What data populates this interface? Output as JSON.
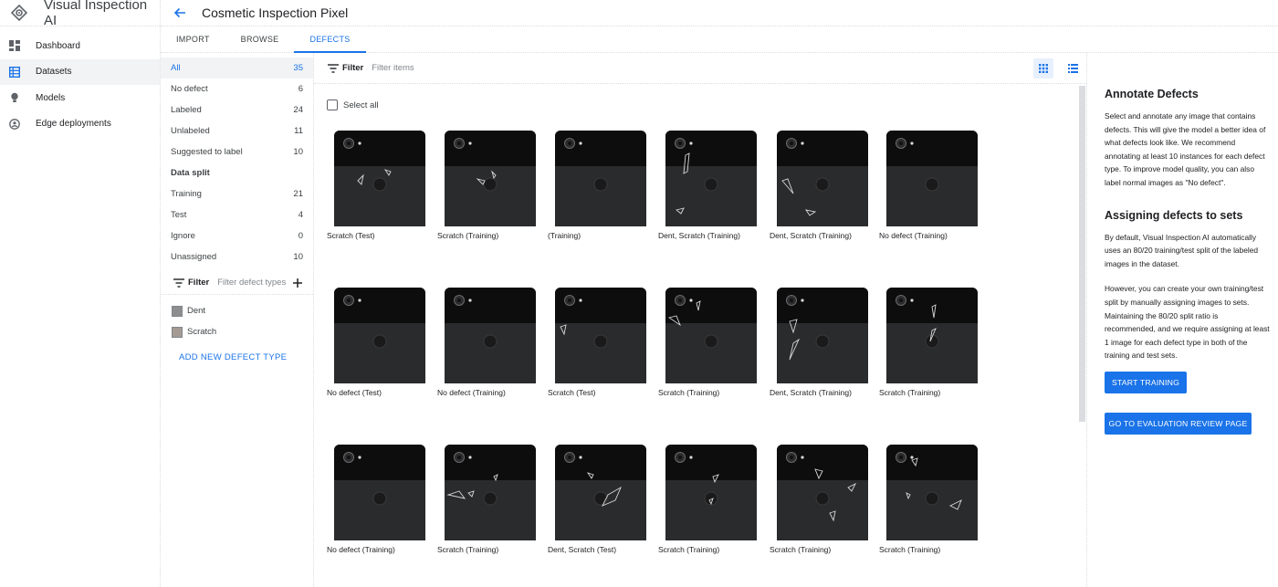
{
  "app": {
    "title": "Visual Inspection AI",
    "nav": [
      {
        "label": "Dashboard",
        "icon": "dashboard-icon"
      },
      {
        "label": "Datasets",
        "icon": "datasets-icon",
        "active": true
      },
      {
        "label": "Models",
        "icon": "lightbulb-icon"
      },
      {
        "label": "Edge deployments",
        "icon": "edge-deployment-icon"
      }
    ]
  },
  "header": {
    "title": "Cosmetic Inspection Pixel",
    "back_icon": "arrow-back-icon"
  },
  "tabs": [
    {
      "label": "IMPORT"
    },
    {
      "label": "BROWSE"
    },
    {
      "label": "DEFECTS",
      "active": true
    }
  ],
  "filters": {
    "all": {
      "label": "All",
      "count": "35"
    },
    "status": [
      {
        "label": "No defect",
        "count": "6"
      },
      {
        "label": "Labeled",
        "count": "24"
      },
      {
        "label": "Unlabeled",
        "count": "11"
      },
      {
        "label": "Suggested to label",
        "count": "10"
      }
    ],
    "split_title": "Data split",
    "split": [
      {
        "label": "Training",
        "count": "21"
      },
      {
        "label": "Test",
        "count": "4"
      },
      {
        "label": "Ignore",
        "count": "0"
      },
      {
        "label": "Unassigned",
        "count": "10"
      }
    ],
    "defect_filter": {
      "label": "Filter",
      "placeholder": "Filter defect types"
    },
    "defect_types": [
      {
        "label": "Dent"
      },
      {
        "label": "Scratch"
      }
    ],
    "add_defect_label": "ADD NEW DEFECT TYPE"
  },
  "grid": {
    "filter_label": "Filter",
    "filter_placeholder": "Filter items",
    "select_all_label": "Select all",
    "images": [
      {
        "label": "Scratch (Test)"
      },
      {
        "label": "Scratch (Training)"
      },
      {
        "label": "(Training)"
      },
      {
        "label": "Dent, Scratch (Training)"
      },
      {
        "label": "Dent, Scratch (Training)"
      },
      {
        "label": "No defect (Training)"
      },
      {
        "label": "No defect (Test)"
      },
      {
        "label": "No defect (Training)"
      },
      {
        "label": "Scratch (Test)"
      },
      {
        "label": "Scratch (Training)"
      },
      {
        "label": "Dent, Scratch (Training)"
      },
      {
        "label": "Scratch (Training)"
      },
      {
        "label": "No defect (Training)"
      },
      {
        "label": "Scratch (Training)"
      },
      {
        "label": "Dent, Scratch (Test)"
      },
      {
        "label": "Scratch (Training)"
      },
      {
        "label": "Scratch (Training)"
      },
      {
        "label": "Scratch (Training)"
      }
    ]
  },
  "right_panel": {
    "heading1": "Annotate Defects",
    "para1": "Select and annotate any image that contains defects. This will give the model a better idea of what defects look like. We recommend annotating at least 10 instances for each defect type. To improve model quality, you can also label normal images as \"No defect\".",
    "heading2": "Assigning defects to sets",
    "para2": "By default, Visual Inspection AI automatically uses an 80/20 training/test split of the labeled images in the dataset.",
    "para3": "However, you can create your own training/test split by manually assigning images to sets. Maintaining the 80/20 split ratio is recommended, and we require assigning at least 1 image for each defect type in both of the training and test sets.",
    "start_training": "START TRAINING",
    "go_eval": "GO TO EVALUATION REVIEW PAGE"
  },
  "colors": {
    "accent": "#1a73e8",
    "active_bg": "#f1f3f4"
  }
}
